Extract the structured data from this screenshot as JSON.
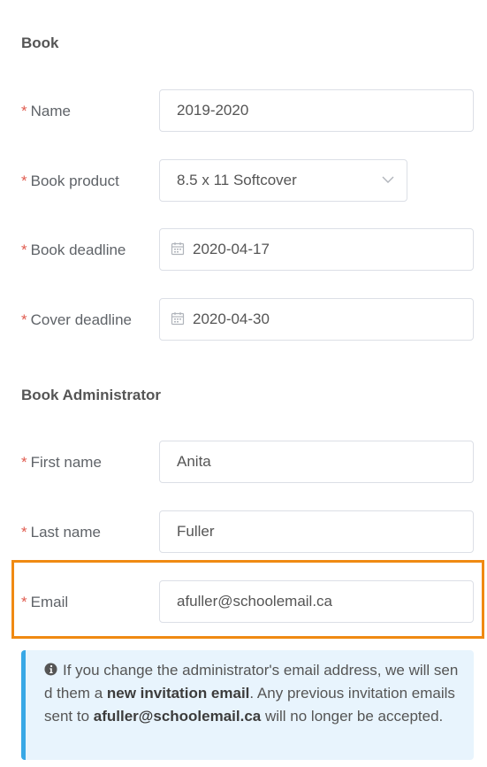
{
  "sections": {
    "book_title": "Book",
    "admin_title": "Book Administrator"
  },
  "required_mark": "*",
  "book": {
    "name": {
      "label": "Name",
      "value": "2019-2020"
    },
    "product": {
      "label": "Book product",
      "value": "8.5 x 11 Softcover",
      "icon": "chevron-down-icon"
    },
    "book_deadline": {
      "label": "Book deadline",
      "value": "2020-04-17",
      "icon": "calendar-icon"
    },
    "cover_deadline": {
      "label": "Cover deadline",
      "value": "2020-04-30",
      "icon": "calendar-icon"
    }
  },
  "admin": {
    "first_name": {
      "label": "First name",
      "value": "Anita"
    },
    "last_name": {
      "label": "Last name",
      "value": "Fuller"
    },
    "email": {
      "label": "Email",
      "value": "afuller@schoolemail.ca"
    }
  },
  "notice": {
    "icon": "info-icon",
    "part1": "If you change the administrator's email address, we will send them a ",
    "bold1": "new invitation email",
    "part2": ". Any previous invitation emails sent to ",
    "bold2": "afuller@schoolemail.ca",
    "part3": " will no longer be accepted."
  },
  "colors": {
    "required": "#e05a4e",
    "highlight_border": "#f08a12",
    "notice_background": "#e8f4fd",
    "notice_border": "#38a8e6"
  }
}
